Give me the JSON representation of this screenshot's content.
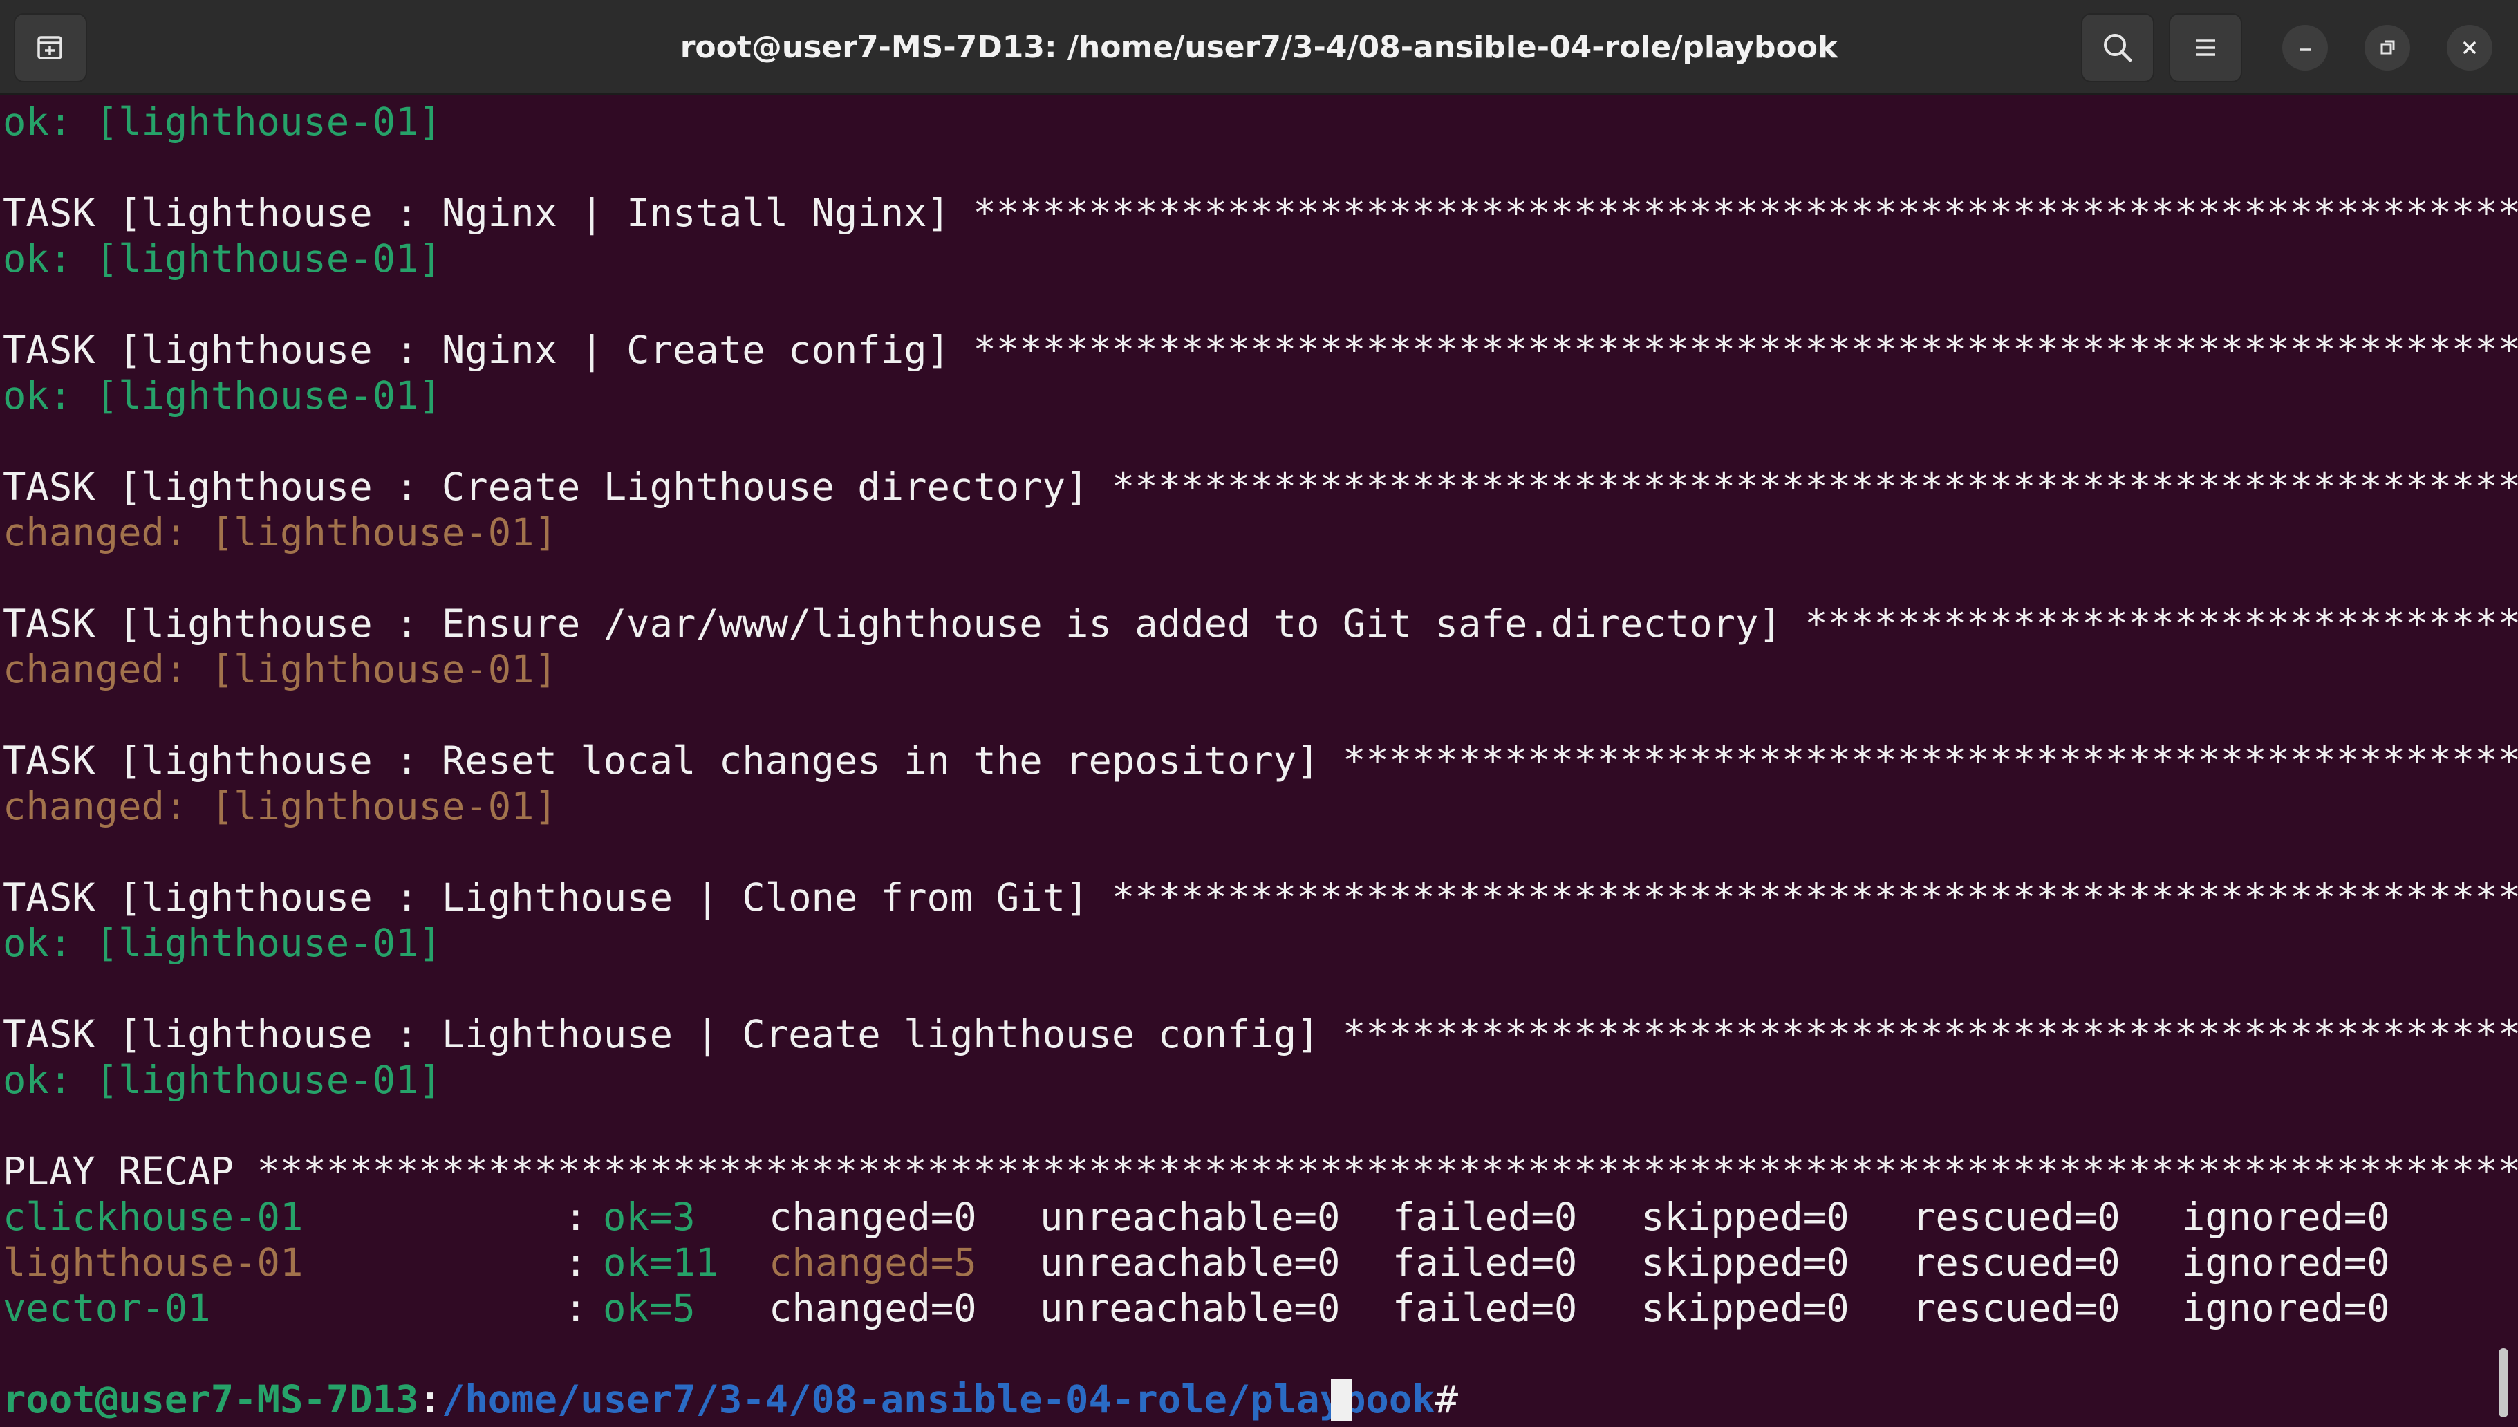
{
  "window": {
    "title": "root@user7-MS-7D13: /home/user7/3-4/08-ansible-04-role/playbook"
  },
  "icons": {
    "new_tab": "new-tab-icon",
    "search": "search-icon",
    "menu": "hamburger-menu-icon",
    "minimize": "minimize-icon",
    "restore": "restore-icon",
    "close": "close-icon"
  },
  "colors": {
    "background": "#300a24",
    "titlebar": "#2c2c2c",
    "ok": "#26a269",
    "changed": "#a2734c",
    "text": "#f0f0f0",
    "prompt_path": "#2a6bc4"
  },
  "terminal": {
    "top_ok": "ok: [lighthouse-01]",
    "tasks": [
      {
        "header": "TASK [lighthouse : Nginx | Install Nginx] ****************************************************************************************************************",
        "result": "ok: [lighthouse-01]",
        "status": "ok"
      },
      {
        "header": "TASK [lighthouse : Nginx | Create config] ****************************************************************************************************************",
        "result": "ok: [lighthouse-01]",
        "status": "ok"
      },
      {
        "header": "TASK [lighthouse : Create Lighthouse directory] **********************************************************************************************************",
        "result": "changed: [lighthouse-01]",
        "status": "changed"
      },
      {
        "header": "TASK [lighthouse : Ensure /var/www/lighthouse is added to Git safe.directory] *********************************************************************",
        "result": "changed: [lighthouse-01]",
        "status": "changed"
      },
      {
        "header": "TASK [lighthouse : Reset local changes in the repository] ************************************************************************************************",
        "result": "changed: [lighthouse-01]",
        "status": "changed"
      },
      {
        "header": "TASK [lighthouse : Lighthouse | Clone from Git] **********************************************************************************************************",
        "result": "ok: [lighthouse-01]",
        "status": "ok"
      },
      {
        "header": "TASK [lighthouse : Lighthouse | Create lighthouse config] ************************************************************************************************",
        "result": "ok: [lighthouse-01]",
        "status": "ok"
      }
    ],
    "recap_header": "PLAY RECAP ***********************************************************************************************************************************************",
    "recap": [
      {
        "host": "clickhouse-01",
        "colon": ":",
        "ok": "ok=3",
        "changed": "changed=0",
        "unreachable": "unreachable=0",
        "failed": "failed=0",
        "skipped": "skipped=0",
        "rescued": "rescued=0",
        "ignored": "ignored=0"
      },
      {
        "host": "lighthouse-01",
        "colon": ":",
        "ok": "ok=11",
        "changed": "changed=5",
        "unreachable": "unreachable=0",
        "failed": "failed=0",
        "skipped": "skipped=0",
        "rescued": "rescued=0",
        "ignored": "ignored=0"
      },
      {
        "host": "vector-01",
        "colon": ":",
        "ok": "ok=5",
        "changed": "changed=0",
        "unreachable": "unreachable=0",
        "failed": "failed=0",
        "skipped": "skipped=0",
        "rescued": "rescued=0",
        "ignored": "ignored=0"
      }
    ],
    "prompt": {
      "user_host": "root@user7-MS-7D13",
      "separator": ":",
      "path": "/home/user7/3-4/08-ansible-04-role/playbook",
      "symbol": "# "
    }
  }
}
